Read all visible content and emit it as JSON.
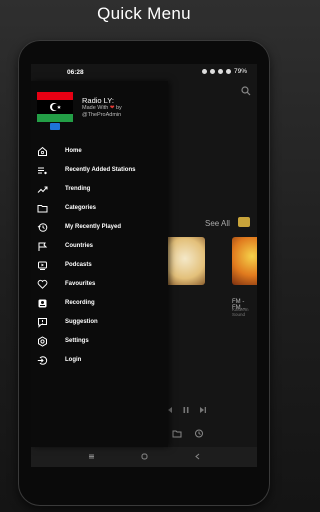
{
  "header": {
    "title": "Quick Menu"
  },
  "status_bar": {
    "time": "06:28",
    "battery": "79%"
  },
  "background": {
    "see_all": "See All",
    "cards": [
      {
        "title": "FM - FM...",
        "subtitle": "Kaseem Sound"
      }
    ]
  },
  "drawer": {
    "app_name": "Radio LY:",
    "made_prefix": "Made With",
    "made_suffix": "by @TheProAdmin",
    "items": [
      {
        "label": "Home",
        "icon": "home-icon"
      },
      {
        "label": "Recently Added Stations",
        "icon": "playlist-icon"
      },
      {
        "label": "Trending",
        "icon": "trending-icon"
      },
      {
        "label": "Categories",
        "icon": "folder-icon"
      },
      {
        "label": "My Recently Played",
        "icon": "history-icon"
      },
      {
        "label": "Countries",
        "icon": "flag-icon"
      },
      {
        "label": "Podcasts",
        "icon": "podcast-icon"
      },
      {
        "label": "Favourites",
        "icon": "heart-icon"
      },
      {
        "label": "Recording",
        "icon": "record-icon"
      },
      {
        "label": "Suggestion",
        "icon": "suggestion-icon"
      },
      {
        "label": "Settings",
        "icon": "gear-icon"
      },
      {
        "label": "Login",
        "icon": "login-icon"
      }
    ]
  },
  "colors": {
    "accent": "#c9a43b",
    "drawer_bg": "#0b0b0b",
    "flag_red": "#e70013",
    "flag_green": "#239e46"
  }
}
